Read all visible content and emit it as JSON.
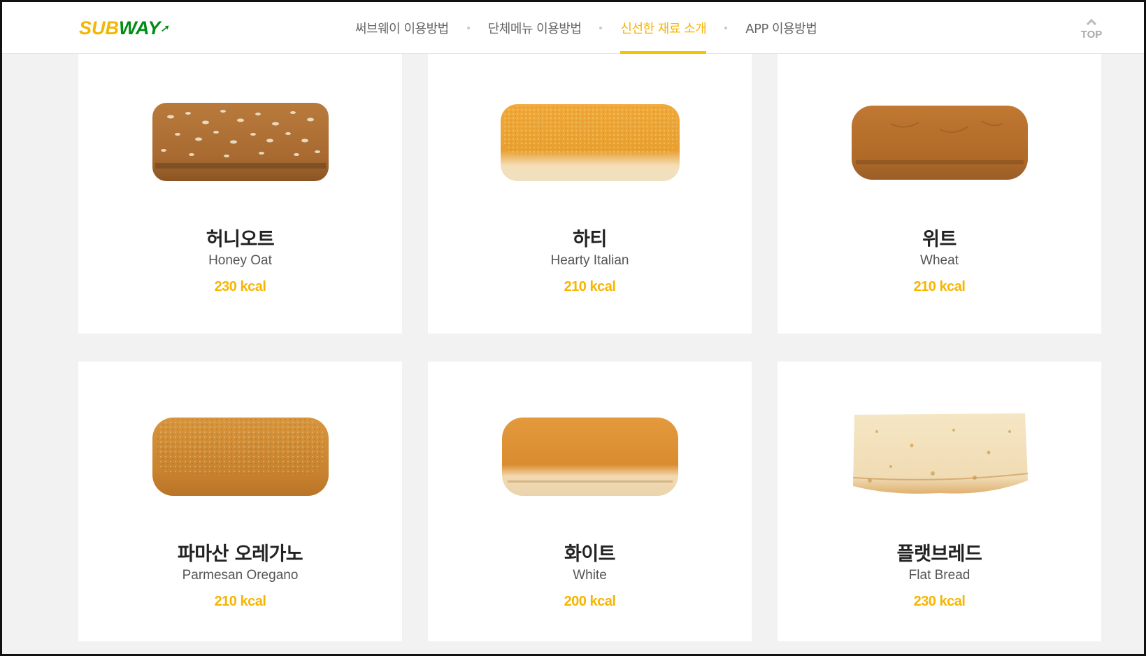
{
  "header": {
    "logo_sub": "SUB",
    "logo_way": "WAY",
    "nav": [
      {
        "label": "써브웨이 이용방법",
        "active": false
      },
      {
        "label": "단체메뉴 이용방법",
        "active": false
      },
      {
        "label": "신선한 재료 소개",
        "active": true
      },
      {
        "label": "APP 이용방법",
        "active": false
      }
    ],
    "top_label": "TOP"
  },
  "breads": [
    {
      "name_ko": "허니오트",
      "name_en": "Honey Oat",
      "kcal": "230 kcal",
      "icon": "honey-oat-bread-image"
    },
    {
      "name_ko": "하티",
      "name_en": "Hearty Italian",
      "kcal": "210 kcal",
      "icon": "hearty-italian-bread-image"
    },
    {
      "name_ko": "위트",
      "name_en": "Wheat",
      "kcal": "210 kcal",
      "icon": "wheat-bread-image"
    },
    {
      "name_ko": "파마산 오레가노",
      "name_en": "Parmesan Oregano",
      "kcal": "210 kcal",
      "icon": "parmesan-oregano-bread-image"
    },
    {
      "name_ko": "화이트",
      "name_en": "White",
      "kcal": "200 kcal",
      "icon": "white-bread-image"
    },
    {
      "name_ko": "플랫브레드",
      "name_en": "Flat Bread",
      "kcal": "230 kcal",
      "icon": "flat-bread-image"
    }
  ],
  "colors": {
    "accent": "#f7b500",
    "brand_yellow": "#f2b705",
    "brand_green": "#008c15",
    "page_bg": "#f2f2f2"
  }
}
